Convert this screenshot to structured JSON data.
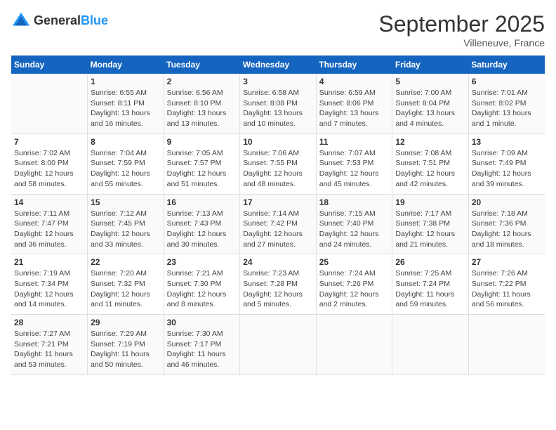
{
  "logo": {
    "general": "General",
    "blue": "Blue"
  },
  "title": "September 2025",
  "location": "Villeneuve, France",
  "days_of_week": [
    "Sunday",
    "Monday",
    "Tuesday",
    "Wednesday",
    "Thursday",
    "Friday",
    "Saturday"
  ],
  "weeks": [
    [
      {
        "day": "",
        "info": ""
      },
      {
        "day": "1",
        "info": "Sunrise: 6:55 AM\nSunset: 8:11 PM\nDaylight: 13 hours\nand 16 minutes."
      },
      {
        "day": "2",
        "info": "Sunrise: 6:56 AM\nSunset: 8:10 PM\nDaylight: 13 hours\nand 13 minutes."
      },
      {
        "day": "3",
        "info": "Sunrise: 6:58 AM\nSunset: 8:08 PM\nDaylight: 13 hours\nand 10 minutes."
      },
      {
        "day": "4",
        "info": "Sunrise: 6:59 AM\nSunset: 8:06 PM\nDaylight: 13 hours\nand 7 minutes."
      },
      {
        "day": "5",
        "info": "Sunrise: 7:00 AM\nSunset: 8:04 PM\nDaylight: 13 hours\nand 4 minutes."
      },
      {
        "day": "6",
        "info": "Sunrise: 7:01 AM\nSunset: 8:02 PM\nDaylight: 13 hours\nand 1 minute."
      }
    ],
    [
      {
        "day": "7",
        "info": "Sunrise: 7:02 AM\nSunset: 8:00 PM\nDaylight: 12 hours\nand 58 minutes."
      },
      {
        "day": "8",
        "info": "Sunrise: 7:04 AM\nSunset: 7:59 PM\nDaylight: 12 hours\nand 55 minutes."
      },
      {
        "day": "9",
        "info": "Sunrise: 7:05 AM\nSunset: 7:57 PM\nDaylight: 12 hours\nand 51 minutes."
      },
      {
        "day": "10",
        "info": "Sunrise: 7:06 AM\nSunset: 7:55 PM\nDaylight: 12 hours\nand 48 minutes."
      },
      {
        "day": "11",
        "info": "Sunrise: 7:07 AM\nSunset: 7:53 PM\nDaylight: 12 hours\nand 45 minutes."
      },
      {
        "day": "12",
        "info": "Sunrise: 7:08 AM\nSunset: 7:51 PM\nDaylight: 12 hours\nand 42 minutes."
      },
      {
        "day": "13",
        "info": "Sunrise: 7:09 AM\nSunset: 7:49 PM\nDaylight: 12 hours\nand 39 minutes."
      }
    ],
    [
      {
        "day": "14",
        "info": "Sunrise: 7:11 AM\nSunset: 7:47 PM\nDaylight: 12 hours\nand 36 minutes."
      },
      {
        "day": "15",
        "info": "Sunrise: 7:12 AM\nSunset: 7:45 PM\nDaylight: 12 hours\nand 33 minutes."
      },
      {
        "day": "16",
        "info": "Sunrise: 7:13 AM\nSunset: 7:43 PM\nDaylight: 12 hours\nand 30 minutes."
      },
      {
        "day": "17",
        "info": "Sunrise: 7:14 AM\nSunset: 7:42 PM\nDaylight: 12 hours\nand 27 minutes."
      },
      {
        "day": "18",
        "info": "Sunrise: 7:15 AM\nSunset: 7:40 PM\nDaylight: 12 hours\nand 24 minutes."
      },
      {
        "day": "19",
        "info": "Sunrise: 7:17 AM\nSunset: 7:38 PM\nDaylight: 12 hours\nand 21 minutes."
      },
      {
        "day": "20",
        "info": "Sunrise: 7:18 AM\nSunset: 7:36 PM\nDaylight: 12 hours\nand 18 minutes."
      }
    ],
    [
      {
        "day": "21",
        "info": "Sunrise: 7:19 AM\nSunset: 7:34 PM\nDaylight: 12 hours\nand 14 minutes."
      },
      {
        "day": "22",
        "info": "Sunrise: 7:20 AM\nSunset: 7:32 PM\nDaylight: 12 hours\nand 11 minutes."
      },
      {
        "day": "23",
        "info": "Sunrise: 7:21 AM\nSunset: 7:30 PM\nDaylight: 12 hours\nand 8 minutes."
      },
      {
        "day": "24",
        "info": "Sunrise: 7:23 AM\nSunset: 7:28 PM\nDaylight: 12 hours\nand 5 minutes."
      },
      {
        "day": "25",
        "info": "Sunrise: 7:24 AM\nSunset: 7:26 PM\nDaylight: 12 hours\nand 2 minutes."
      },
      {
        "day": "26",
        "info": "Sunrise: 7:25 AM\nSunset: 7:24 PM\nDaylight: 11 hours\nand 59 minutes."
      },
      {
        "day": "27",
        "info": "Sunrise: 7:26 AM\nSunset: 7:22 PM\nDaylight: 11 hours\nand 56 minutes."
      }
    ],
    [
      {
        "day": "28",
        "info": "Sunrise: 7:27 AM\nSunset: 7:21 PM\nDaylight: 11 hours\nand 53 minutes."
      },
      {
        "day": "29",
        "info": "Sunrise: 7:29 AM\nSunset: 7:19 PM\nDaylight: 11 hours\nand 50 minutes."
      },
      {
        "day": "30",
        "info": "Sunrise: 7:30 AM\nSunset: 7:17 PM\nDaylight: 11 hours\nand 46 minutes."
      },
      {
        "day": "",
        "info": ""
      },
      {
        "day": "",
        "info": ""
      },
      {
        "day": "",
        "info": ""
      },
      {
        "day": "",
        "info": ""
      }
    ]
  ]
}
